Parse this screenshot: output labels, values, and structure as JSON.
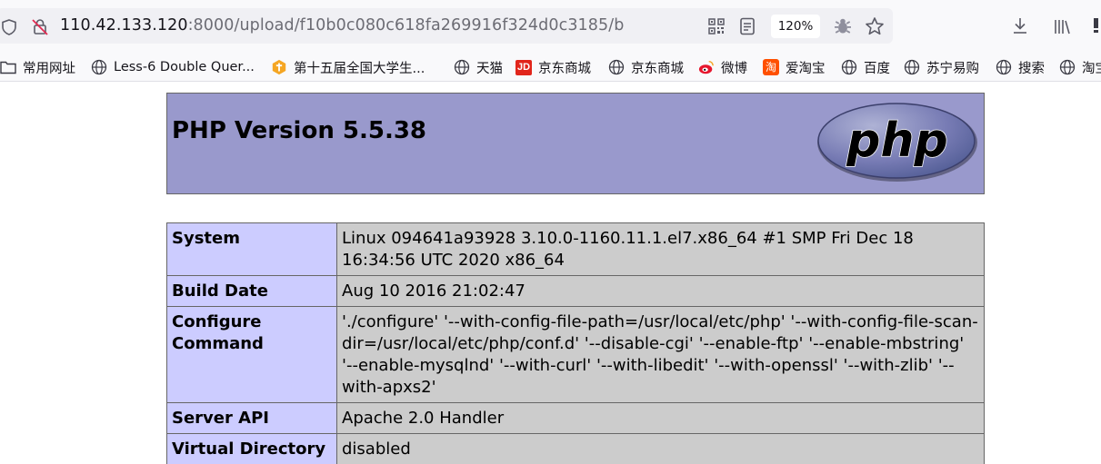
{
  "browser": {
    "url_host": "110.42.133.120",
    "url_rest": ":8000/upload/f10b0c080c618fa269916f324d0c3185/b",
    "zoom": "120%",
    "icons": [
      "shield-icon",
      "insecure-lock-icon",
      "qr-code-icon",
      "reader-view-icon",
      "bug-icon",
      "bookmark-star-icon",
      "download-icon",
      "library-icon",
      "more-icon"
    ]
  },
  "bookmarks": [
    {
      "label": "常用网址",
      "icon": "folder-icon"
    },
    {
      "label": "Less-6 Double Quer...",
      "icon": "globe-icon"
    },
    {
      "label": "第十五届全国大学生...",
      "icon": "site-icon"
    },
    {
      "label": "天猫",
      "icon": "globe-icon"
    },
    {
      "label": "京东商城",
      "icon": "jd-icon",
      "icon_text": "JD"
    },
    {
      "label": "京东商城",
      "icon": "globe-icon"
    },
    {
      "label": "微博",
      "icon": "weibo-icon"
    },
    {
      "label": "爱淘宝",
      "icon": "taobao-icon",
      "icon_text": "淘"
    },
    {
      "label": "百度",
      "icon": "globe-icon"
    },
    {
      "label": "苏宁易购",
      "icon": "globe-icon"
    },
    {
      "label": "搜索",
      "icon": "globe-icon"
    },
    {
      "label": "淘宝",
      "icon": "globe-icon"
    }
  ],
  "php": {
    "title": "PHP Version 5.5.38",
    "logo_text": "php",
    "colors": {
      "header": "#9999cc",
      "key_cell": "#ccccff",
      "value_cell": "#cccccc",
      "border": "#666666"
    },
    "rows": [
      {
        "key": "System",
        "value": "Linux 094641a93928 3.10.0-1160.11.1.el7.x86_64 #1 SMP Fri Dec 18 16:34:56 UTC 2020 x86_64"
      },
      {
        "key": "Build Date",
        "value": "Aug 10 2016 21:02:47"
      },
      {
        "key": "Configure Command",
        "value": "'./configure' '--with-config-file-path=/usr/local/etc/php' '--with-config-file-scan-dir=/usr/local/etc/php/conf.d' '--disable-cgi' '--enable-ftp' '--enable-mbstring' '--enable-mysqlnd' '--with-curl' '--with-libedit' '--with-openssl' '--with-zlib' '--with-apxs2'"
      },
      {
        "key": "Server API",
        "value": "Apache 2.0 Handler"
      },
      {
        "key": "Virtual Directory",
        "value": "disabled"
      }
    ]
  }
}
